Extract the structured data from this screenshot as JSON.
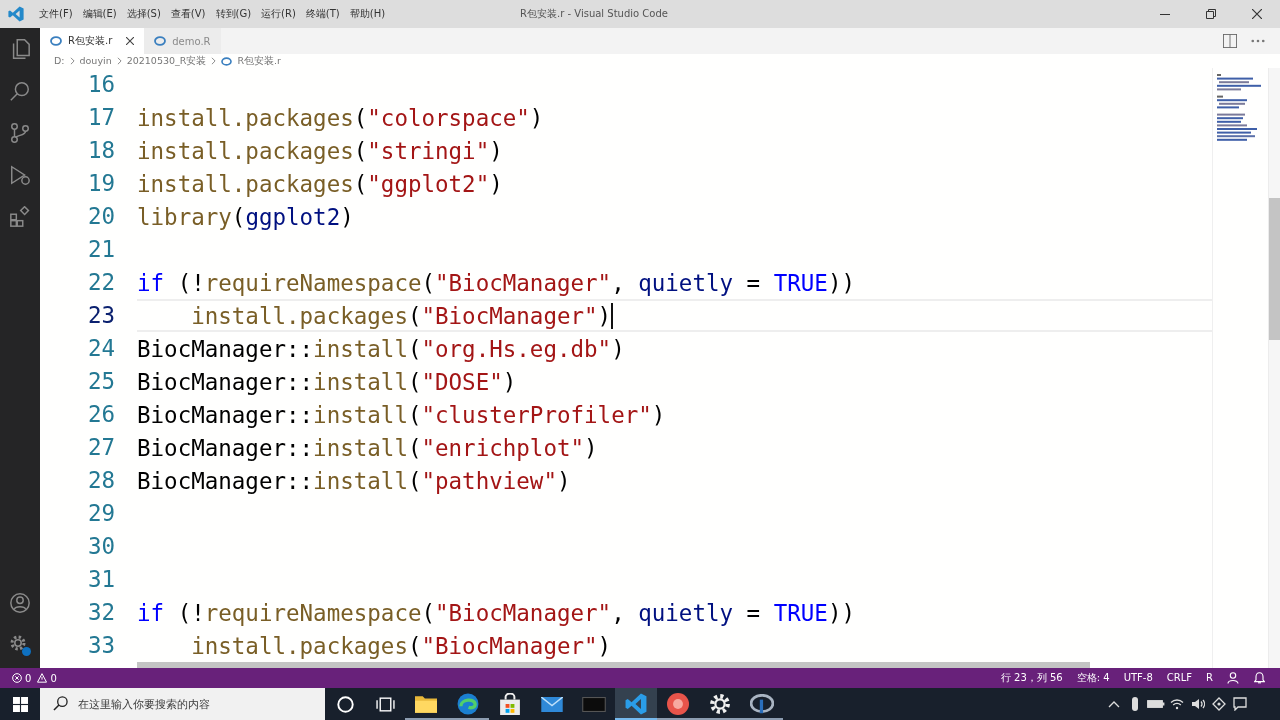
{
  "window": {
    "title": "R包安装.r - Visual Studio Code"
  },
  "menu": [
    "文件(F)",
    "编辑(E)",
    "选择(S)",
    "查看(V)",
    "转到(G)",
    "运行(R)",
    "终端(T)",
    "帮助(H)"
  ],
  "tabs": [
    {
      "label": "R包安装.r",
      "selected": true
    },
    {
      "label": "demo.R",
      "selected": false
    }
  ],
  "breadcrumb": [
    {
      "kind": "folder",
      "label": "D:"
    },
    {
      "kind": "folder",
      "label": "douyin"
    },
    {
      "kind": "folder",
      "label": "20210530_R安装"
    },
    {
      "kind": "file",
      "label": "R包安装.r"
    }
  ],
  "editor": {
    "lines": [
      {
        "number": "16",
        "current": false
      },
      {
        "number": "17",
        "current": false,
        "tokens": [
          {
            "kind": "fn",
            "text": "install.packages"
          },
          {
            "kind": "plain",
            "text": "("
          },
          {
            "kind": "str",
            "text": "\"colorspace\""
          },
          {
            "kind": "plain",
            "text": ")"
          }
        ]
      },
      {
        "number": "18",
        "current": false,
        "tokens": [
          {
            "kind": "fn",
            "text": "install.packages"
          },
          {
            "kind": "plain",
            "text": "("
          },
          {
            "kind": "str",
            "text": "\"stringi\""
          },
          {
            "kind": "plain",
            "text": ")"
          }
        ]
      },
      {
        "number": "19",
        "current": false,
        "tokens": [
          {
            "kind": "fn",
            "text": "install.packages"
          },
          {
            "kind": "plain",
            "text": "("
          },
          {
            "kind": "str",
            "text": "\"ggplot2\""
          },
          {
            "kind": "plain",
            "text": ")"
          }
        ]
      },
      {
        "number": "20",
        "current": false,
        "tokens": [
          {
            "kind": "fn",
            "text": "library"
          },
          {
            "kind": "plain",
            "text": "("
          },
          {
            "kind": "var",
            "text": "ggplot2"
          },
          {
            "kind": "plain",
            "text": ")"
          }
        ]
      },
      {
        "number": "21",
        "current": false
      },
      {
        "number": "22",
        "current": false,
        "tokens": [
          {
            "kind": "kw",
            "text": "if"
          },
          {
            "kind": "plain",
            "text": " (!"
          },
          {
            "kind": "fn",
            "text": "requireNamespace"
          },
          {
            "kind": "plain",
            "text": "("
          },
          {
            "kind": "str",
            "text": "\"BiocManager\""
          },
          {
            "kind": "plain",
            "text": ", "
          },
          {
            "kind": "var",
            "text": "quietly"
          },
          {
            "kind": "plain",
            "text": " = "
          },
          {
            "kind": "const",
            "text": "TRUE"
          },
          {
            "kind": "plain",
            "text": "))"
          }
        ]
      },
      {
        "number": "23",
        "current": true,
        "tokens": [
          {
            "kind": "fn",
            "text": "    install.packages"
          },
          {
            "kind": "plain",
            "text": "("
          },
          {
            "kind": "str",
            "text": "\"BiocManager\""
          },
          {
            "kind": "plain",
            "text": ")"
          }
        ]
      },
      {
        "number": "24",
        "current": false,
        "tokens": [
          {
            "kind": "plain",
            "text": "BiocManager::"
          },
          {
            "kind": "fn",
            "text": "install"
          },
          {
            "kind": "plain",
            "text": "("
          },
          {
            "kind": "str",
            "text": "\"org.Hs.eg.db\""
          },
          {
            "kind": "plain",
            "text": ")"
          }
        ]
      },
      {
        "number": "25",
        "current": false,
        "tokens": [
          {
            "kind": "plain",
            "text": "BiocManager::"
          },
          {
            "kind": "fn",
            "text": "install"
          },
          {
            "kind": "plain",
            "text": "("
          },
          {
            "kind": "str",
            "text": "\"DOSE\""
          },
          {
            "kind": "plain",
            "text": ")"
          }
        ]
      },
      {
        "number": "26",
        "current": false,
        "tokens": [
          {
            "kind": "plain",
            "text": "BiocManager::"
          },
          {
            "kind": "fn",
            "text": "install"
          },
          {
            "kind": "plain",
            "text": "("
          },
          {
            "kind": "str",
            "text": "\"clusterProfiler\""
          },
          {
            "kind": "plain",
            "text": ")"
          }
        ]
      },
      {
        "number": "27",
        "current": false,
        "tokens": [
          {
            "kind": "plain",
            "text": "BiocManager::"
          },
          {
            "kind": "fn",
            "text": "install"
          },
          {
            "kind": "plain",
            "text": "("
          },
          {
            "kind": "str",
            "text": "\"enrichplot\""
          },
          {
            "kind": "plain",
            "text": ")"
          }
        ]
      },
      {
        "number": "28",
        "current": false,
        "tokens": [
          {
            "kind": "plain",
            "text": "BiocManager::"
          },
          {
            "kind": "fn",
            "text": "install"
          },
          {
            "kind": "plain",
            "text": "("
          },
          {
            "kind": "str",
            "text": "\"pathview\""
          },
          {
            "kind": "plain",
            "text": ")"
          }
        ]
      },
      {
        "number": "29",
        "current": false
      },
      {
        "number": "30",
        "current": false
      },
      {
        "number": "31",
        "current": false
      },
      {
        "number": "32",
        "current": false,
        "tokens": [
          {
            "kind": "kw",
            "text": "if"
          },
          {
            "kind": "plain",
            "text": " (!"
          },
          {
            "kind": "fn",
            "text": "requireNamespace"
          },
          {
            "kind": "plain",
            "text": "("
          },
          {
            "kind": "str",
            "text": "\"BiocManager\""
          },
          {
            "kind": "plain",
            "text": ", "
          },
          {
            "kind": "var",
            "text": "quietly"
          },
          {
            "kind": "plain",
            "text": " = "
          },
          {
            "kind": "const",
            "text": "TRUE"
          },
          {
            "kind": "plain",
            "text": "))"
          }
        ]
      },
      {
        "number": "33",
        "current": false,
        "tokens": [
          {
            "kind": "fn",
            "text": "    install.packages"
          },
          {
            "kind": "plain",
            "text": "("
          },
          {
            "kind": "str",
            "text": "\"BiocManager\""
          },
          {
            "kind": "plain",
            "text": ")"
          }
        ]
      }
    ]
  },
  "status_bar": {
    "errors": "0",
    "warnings": "0",
    "items": [
      "行 23，列 56",
      "空格: 4",
      "UTF-8",
      "CRLF",
      "R"
    ]
  },
  "taskbar": {
    "search": {
      "placeholder": "在这里输入你要搜索的内容"
    },
    "apps": [
      {
        "kind": "folder",
        "open": true,
        "selected": false
      },
      {
        "kind": "browser",
        "open": true,
        "selected": false
      },
      {
        "kind": "bag",
        "open": false,
        "selected": false
      },
      {
        "kind": "mail",
        "open": false,
        "selected": false
      },
      {
        "kind": "terminal",
        "open": false,
        "selected": false
      },
      {
        "kind": "editor",
        "open": true,
        "selected": true
      },
      {
        "kind": "ball",
        "open": true,
        "selected": false
      },
      {
        "kind": "gear",
        "open": true,
        "selected": false
      },
      {
        "kind": "ring",
        "open": true,
        "selected": false
      }
    ]
  }
}
